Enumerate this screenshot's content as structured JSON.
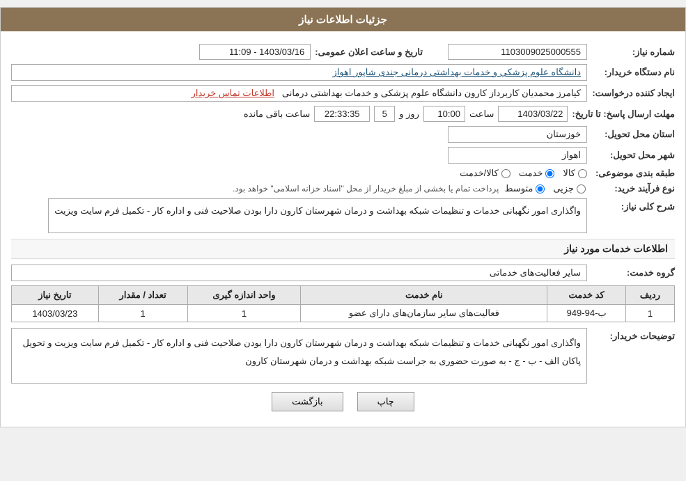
{
  "header": {
    "title": "جزئیات اطلاعات نیاز"
  },
  "fields": {
    "need_number_label": "شماره نیاز:",
    "need_number_value": "1103009025000555",
    "org_label": "نام دستگاه خریدار:",
    "org_value": "دانشگاه علوم پزشکی و خدمات بهداشتی درمانی جندی شاپور اهواز",
    "creator_label": "ایجاد کننده درخواست:",
    "creator_value": "کیامرز محمدیان کاربرداز کارون دانشگاه علوم پزشکی و خدمات بهداشتی درمانی",
    "creator_link": "اطلاعات تماس خریدار",
    "date_label": "مهلت ارسال پاسخ: تا تاریخ:",
    "deadline_date": "1403/03/22",
    "time_label": "ساعت",
    "time_value": "10:00",
    "day_label": "روز و",
    "day_value": "5",
    "remaining_label": "ساعت باقی مانده",
    "remaining_value": "22:33:35",
    "announce_label": "تاریخ و ساعت اعلان عمومی:",
    "announce_value": "1403/03/16 - 11:09",
    "province_label": "استان محل تحویل:",
    "province_value": "خوزستان",
    "city_label": "شهر محل تحویل:",
    "city_value": "اهواز",
    "category_label": "طبقه بندی موضوعی:",
    "category_options": [
      "کالا",
      "خدمت",
      "کالا/خدمت"
    ],
    "category_selected": "خدمت",
    "process_label": "نوع فرآیند خرید:",
    "process_options": [
      "جزیی",
      "متوسط"
    ],
    "process_note": "پرداخت تمام یا بخشی از مبلغ خریدار از محل \"اسناد خزانه اسلامی\" خواهد بود.",
    "need_desc_label": "شرح کلی نیاز:",
    "need_desc_value": "واگذاری امور نگهبانی خدمات و تنظیمات شبکه بهداشت و درمان شهرستان کارون  دارا بودن صلاحیت فنی و اداره کار - تکمیل فرم سایت ویزیت",
    "service_info_title": "اطلاعات خدمات مورد نیاز",
    "service_group_label": "گروه خدمت:",
    "service_group_value": "سایر فعالیت‌های خدماتی",
    "table": {
      "headers": [
        "ردیف",
        "کد خدمت",
        "نام خدمت",
        "واحد اندازه گیری",
        "تعداد / مقدار",
        "تاریخ نیاز"
      ],
      "rows": [
        {
          "row": "1",
          "code": "ب-94-949",
          "name": "فعالیت‌های سایر سازمان‌های دارای عضو",
          "unit": "1",
          "qty": "1",
          "date": "1403/03/23"
        }
      ]
    },
    "buyer_desc_label": "توضیحات خریدار:",
    "buyer_desc_value": "واگذاری امور نگهبانی خدمات و تنظیمات شبکه بهداشت و درمان شهرستان کارون  دارا بودن صلاحیت فنی و اداره کار - تکمیل فرم سایت ویزیت و تحویل پاکان الف - ب - ج - به صورت حضوری به جراست شبکه بهداشت و درمان شهرستان کارون"
  },
  "buttons": {
    "back_label": "بازگشت",
    "print_label": "چاپ"
  }
}
